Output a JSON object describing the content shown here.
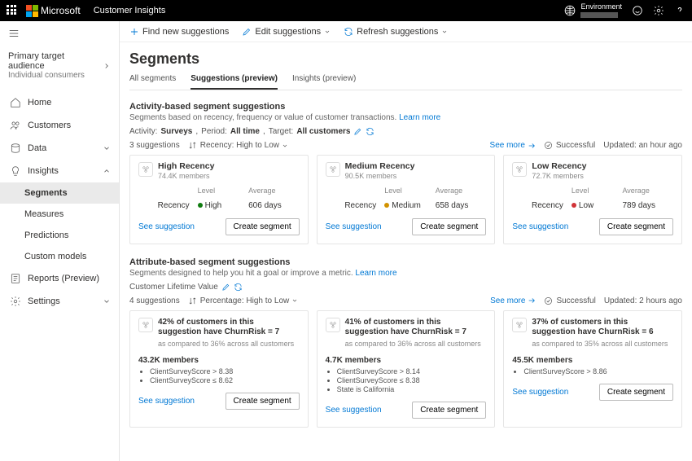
{
  "topbar": {
    "brand": "Microsoft",
    "product": "Customer Insights",
    "env_label": "Environment"
  },
  "side": {
    "audience_label": "Primary target audience",
    "audience_value": "Individual consumers",
    "home": "Home",
    "customers": "Customers",
    "data": "Data",
    "insights": "Insights",
    "segments": "Segments",
    "measures": "Measures",
    "predictions": "Predictions",
    "custom_models": "Custom models",
    "reports": "Reports (Preview)",
    "settings": "Settings"
  },
  "cmd": {
    "find": "Find new suggestions",
    "edit": "Edit suggestions",
    "refresh": "Refresh suggestions"
  },
  "page_title": "Segments",
  "tabs": {
    "all": "All segments",
    "sugg": "Suggestions (preview)",
    "ins": "Insights (preview)"
  },
  "activity": {
    "title": "Activity-based segment suggestions",
    "desc": "Segments based on recency, frequency or value of customer transactions.",
    "learn": "Learn more",
    "f_activity_l": "Activity:",
    "f_activity_v": "Surveys",
    "f_period_l": "Period:",
    "f_period_v": "All time",
    "f_target_l": "Target:",
    "f_target_v": "All customers",
    "count": "3 suggestions",
    "sort": "Recency: High to Low",
    "see_more": "See more",
    "status": "Successful",
    "updated": "Updated: an hour ago",
    "hdr_level": "Level",
    "hdr_avg": "Average",
    "row_label": "Recency",
    "see_link": "See suggestion",
    "create": "Create segment",
    "cards": [
      {
        "title": "High Recency",
        "members": "74.4K members",
        "level": "High",
        "dot": "high",
        "avg": "606 days"
      },
      {
        "title": "Medium Recency",
        "members": "90.5K members",
        "level": "Medium",
        "dot": "med",
        "avg": "658 days"
      },
      {
        "title": "Low Recency",
        "members": "72.7K members",
        "level": "Low",
        "dot": "low",
        "avg": "789 days"
      }
    ]
  },
  "attribute": {
    "title": "Attribute-based segment suggestions",
    "desc": "Segments designed to help you hit a goal or improve a metric.",
    "learn": "Learn more",
    "filter": "Customer Lifetime Value",
    "count": "4 suggestions",
    "sort": "Percentage: High to Low",
    "see_more": "See more",
    "status": "Successful",
    "updated": "Updated: 2 hours ago",
    "see_link": "See suggestion",
    "create": "Create segment",
    "cards": [
      {
        "headline": "42% of customers in this suggestion have ChurnRisk = 7",
        "compare": "as compared to 36% across all customers",
        "members": "43.2K members",
        "criteria": [
          "ClientSurveyScore > 8.38",
          "ClientSurveyScore ≤ 8.62"
        ]
      },
      {
        "headline": "41% of customers in this suggestion have ChurnRisk = 7",
        "compare": "as compared to 36% across all customers",
        "members": "4.7K members",
        "criteria": [
          "ClientSurveyScore > 8.14",
          "ClientSurveyScore ≤ 8.38",
          "State is California"
        ]
      },
      {
        "headline": "37% of customers in this suggestion have ChurnRisk = 6",
        "compare": "as compared to 35% across all customers",
        "members": "45.5K members",
        "criteria": [
          "ClientSurveyScore > 8.86"
        ]
      }
    ]
  }
}
